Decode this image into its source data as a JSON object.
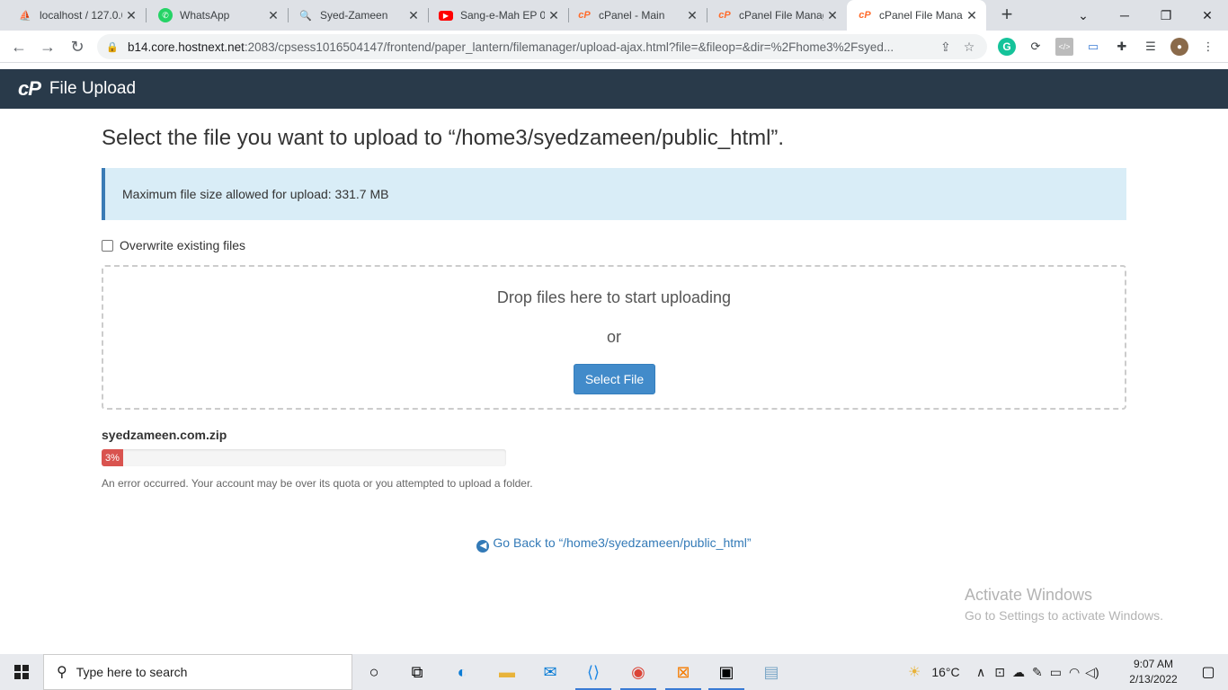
{
  "browser": {
    "tabs": [
      {
        "title": "localhost / 127.0.0",
        "icon": "phpmyadmin-icon"
      },
      {
        "title": "WhatsApp",
        "icon": "whatsapp-icon"
      },
      {
        "title": "Syed-Zameen",
        "icon": "search-doc-icon"
      },
      {
        "title": "Sang-e-Mah EP 0",
        "icon": "youtube-icon"
      },
      {
        "title": "cPanel - Main",
        "icon": "cpanel-icon"
      },
      {
        "title": "cPanel File Manag",
        "icon": "cpanel-icon"
      },
      {
        "title": "cPanel File Mana",
        "icon": "cpanel-icon",
        "active": true
      }
    ],
    "url_host": "b14.core.hostnext.net",
    "url_rest": ":2083/cpsess1016504147/frontend/paper_lantern/filemanager/upload-ajax.html?file=&fileop=&dir=%2Fhome3%2Fsyed..."
  },
  "header": {
    "logo": "cP",
    "title": "File Upload"
  },
  "main": {
    "heading": "Select the file you want to upload to “/home3/syedzameen/public_html”.",
    "max_size_notice": "Maximum file size allowed for upload: 331.7 MB",
    "overwrite_label": "Overwrite existing files",
    "drop_text": "Drop files here to start uploading",
    "or_text": "or",
    "select_button": "Select File",
    "upload": {
      "filename": "syedzameen.com.zip",
      "progress_percent": 3,
      "progress_label": "3%",
      "error_message": "An error occurred. Your account may be over its quota or you attempted to upload a folder."
    },
    "go_back": "Go Back to “/home3/syedzameen/public_html”"
  },
  "watermark": {
    "line1": "Activate Windows",
    "line2": "Go to Settings to activate Windows."
  },
  "taskbar": {
    "search_placeholder": "Type here to search",
    "weather": "16°C",
    "time": "9:07 AM",
    "date": "2/13/2022"
  },
  "colors": {
    "header_bg": "#293a4a",
    "alert_bg": "#d9edf7",
    "button_blue": "#428bca",
    "progress_red": "#d9534f",
    "link_blue": "#337ab7"
  }
}
